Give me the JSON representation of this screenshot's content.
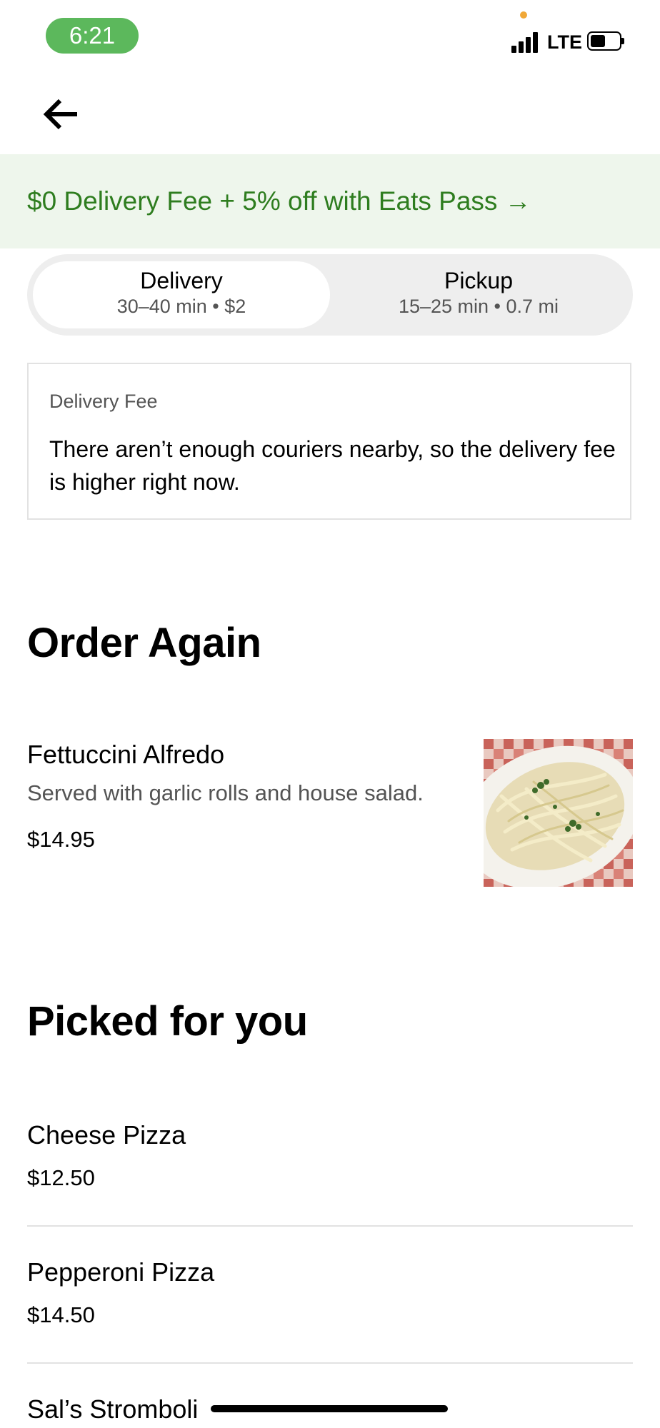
{
  "status_bar": {
    "time": "6:21",
    "network": "LTE",
    "time_pill_color": "#5cb85c"
  },
  "promo": {
    "text": "$0 Delivery Fee + 5% off with Eats Pass →",
    "color": "#2e7d1f"
  },
  "mode_toggle": {
    "delivery": {
      "label": "Delivery",
      "detail": "30–40 min • $2",
      "selected": true
    },
    "pickup": {
      "label": "Pickup",
      "detail": "15–25 min • 0.7 mi",
      "selected": false
    }
  },
  "fee_notice": {
    "label": "Delivery Fee",
    "body": "There aren’t enough couriers nearby, so the delivery fee is higher right now."
  },
  "order_again": {
    "heading": "Order Again",
    "item": {
      "name": "Fettuccini Alfredo",
      "description": "Served with garlic rolls and house salad.",
      "price": "$14.95"
    }
  },
  "picked_for_you": {
    "heading": "Picked for you",
    "items": [
      {
        "name": "Cheese Pizza",
        "price": "$12.50"
      },
      {
        "name": "Pepperoni Pizza",
        "price": "$14.50"
      },
      {
        "name": "Sal’s Stromboli"
      }
    ]
  },
  "icons": {
    "back": "arrow-left-icon",
    "signal": "cellular-signal-icon",
    "battery": "battery-icon"
  }
}
